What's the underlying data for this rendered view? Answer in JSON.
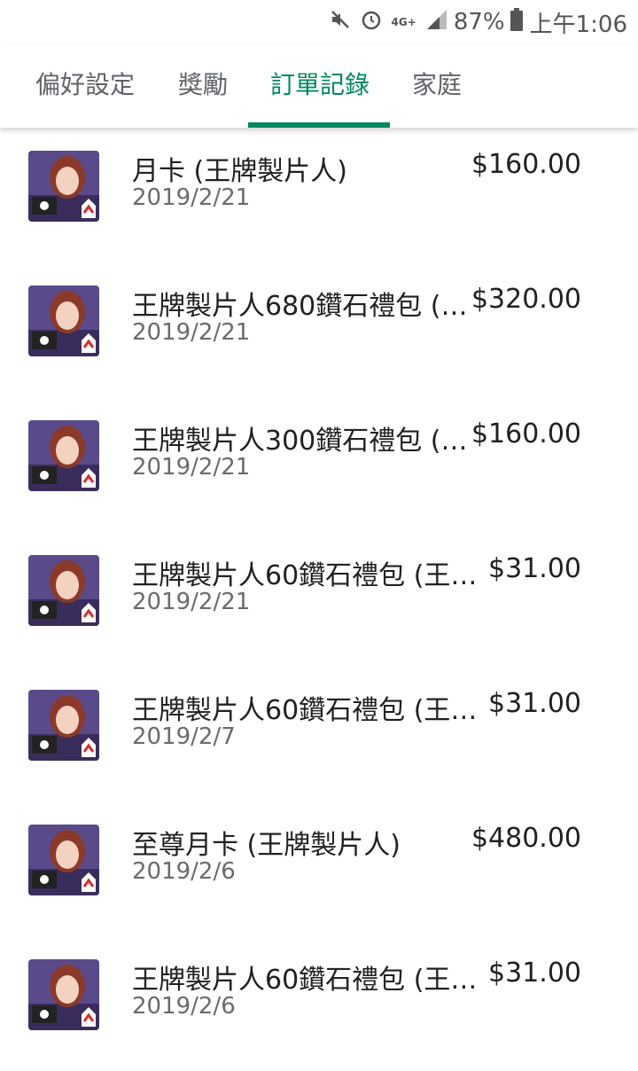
{
  "status_bar": {
    "battery": "87%",
    "time": "上午1:06",
    "network": "4G+"
  },
  "tabs": [
    {
      "label": "偏好設定"
    },
    {
      "label": "獎勵"
    },
    {
      "label": "訂單記錄"
    },
    {
      "label": "家庭"
    }
  ],
  "orders": [
    {
      "title": "月卡 (王牌製片人)",
      "date": "2019/2/21",
      "price": "$160.00"
    },
    {
      "title": "王牌製片人680鑽石禮包 (…",
      "date": "2019/2/21",
      "price": "$320.00"
    },
    {
      "title": "王牌製片人300鑽石禮包 (…",
      "date": "2019/2/21",
      "price": "$160.00"
    },
    {
      "title": "王牌製片人60鑽石禮包 (王…",
      "date": "2019/2/21",
      "price": "$31.00"
    },
    {
      "title": "王牌製片人60鑽石禮包 (王…",
      "date": "2019/2/7",
      "price": "$31.00"
    },
    {
      "title": "至尊月卡 (王牌製片人)",
      "date": "2019/2/6",
      "price": "$480.00"
    },
    {
      "title": "王牌製片人60鑽石禮包 (王…",
      "date": "2019/2/6",
      "price": "$31.00"
    }
  ]
}
